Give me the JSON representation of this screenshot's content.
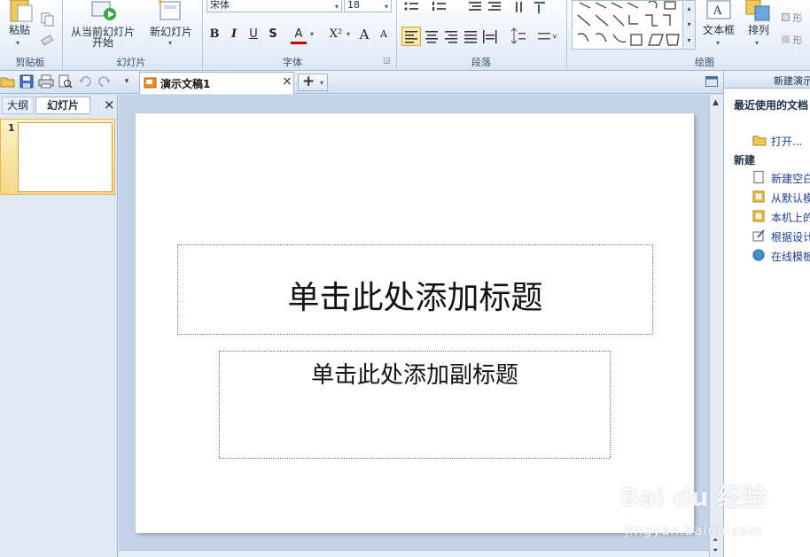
{
  "ribbon": {
    "clipboard": {
      "paste_label": "粘贴",
      "group_label": "剪贴板"
    },
    "slides": {
      "from_current_line1": "从当前幻灯片",
      "from_current_line2": "开始",
      "new_slide_label": "新幻灯片",
      "group_label": "幻灯片"
    },
    "font": {
      "font_name": "宋体",
      "font_size": "18",
      "bold": "B",
      "italic": "I",
      "underline": "U",
      "shadow": "S",
      "color": "A",
      "superscript": "X²",
      "grow": "A",
      "shrink": "A",
      "group_label": "字体"
    },
    "paragraph": {
      "group_label": "段落"
    },
    "drawing": {
      "textbox_label": "文本框",
      "arrange_label": "排列",
      "shape_fill_label": "形",
      "shape_outline_label": "形",
      "group_label": "绘图"
    }
  },
  "qat": {
    "doc_tab_title": "演示文稿1",
    "close_glyph": "×",
    "new_tab_glyph": "+"
  },
  "left_pane": {
    "tab_outline": "大纲",
    "tab_slides": "幻灯片",
    "close_glyph": "×",
    "thumb_number": "1"
  },
  "slide": {
    "title_placeholder": "单击此处添加标题",
    "subtitle_placeholder": "单击此处添加副标题"
  },
  "right_pane": {
    "header": "新建演示",
    "recent_heading": "最近使用的文档",
    "open_label": "打开...",
    "new_heading": "新建",
    "items": [
      "新建空白",
      "从默认模",
      "本机上的",
      "根据设计",
      "在线模板"
    ]
  },
  "watermark": {
    "brand": "Bai du 经验",
    "url": "jingyan.baidu.com"
  },
  "colors": {
    "accent_blue": "#1a3ea0",
    "ribbon_bg": "#e7eef8",
    "canvas_bg": "#c3d2e6",
    "thumb_border": "#e8b64a"
  }
}
